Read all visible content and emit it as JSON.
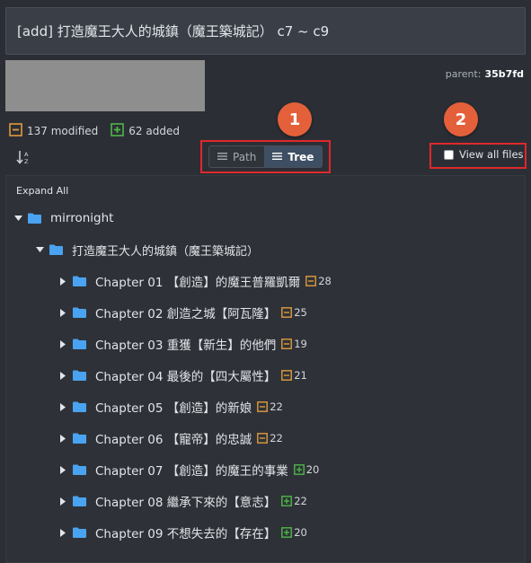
{
  "commit": {
    "title": "[add] 打造魔王大人的城鎮（魔王築城記） c7 ~ c9",
    "parent_label": "parent:",
    "parent_hash": "35b7fd"
  },
  "stats": {
    "modified_label": "137 modified",
    "added_label": "62 added"
  },
  "markers": {
    "one": "1",
    "two": "2"
  },
  "view_toggle": {
    "path_label": "Path",
    "tree_label": "Tree",
    "selected": "Tree"
  },
  "view_all": {
    "label": "View all files",
    "checked": false
  },
  "tree": {
    "expand_all": "Expand All",
    "root": "mirronight",
    "subfolder": "打造魔王大人的城鎮（魔王築城記）",
    "chapters": [
      {
        "name": "Chapter 01 【創造】的魔王普羅凱爾",
        "count": "28",
        "status": "modified"
      },
      {
        "name": "Chapter 02 創造之城【阿瓦隆】",
        "count": "25",
        "status": "modified"
      },
      {
        "name": "Chapter 03 重獲【新生】的他們",
        "count": "19",
        "status": "modified"
      },
      {
        "name": "Chapter 04 最後的【四大屬性】",
        "count": "21",
        "status": "modified"
      },
      {
        "name": "Chapter 05 【創造】的新娘",
        "count": "22",
        "status": "modified"
      },
      {
        "name": "Chapter 06 【寵帝】的忠誠",
        "count": "22",
        "status": "modified"
      },
      {
        "name": "Chapter 07 【創造】的魔王的事業",
        "count": "20",
        "status": "added"
      },
      {
        "name": "Chapter 08 繼承下來的【意志】",
        "count": "22",
        "status": "added"
      },
      {
        "name": "Chapter 09 不想失去的【存在】",
        "count": "20",
        "status": "added"
      }
    ]
  },
  "colors": {
    "folder": "#4aa3f0",
    "modified": "#e09a3c",
    "added": "#4fb548",
    "highlight": "#e0282b",
    "marker": "#e4603a"
  },
  "icons": {
    "modified": "modified-square-icon",
    "added": "added-square-icon",
    "folder": "folder-icon",
    "sort": "sort-az-icon"
  }
}
